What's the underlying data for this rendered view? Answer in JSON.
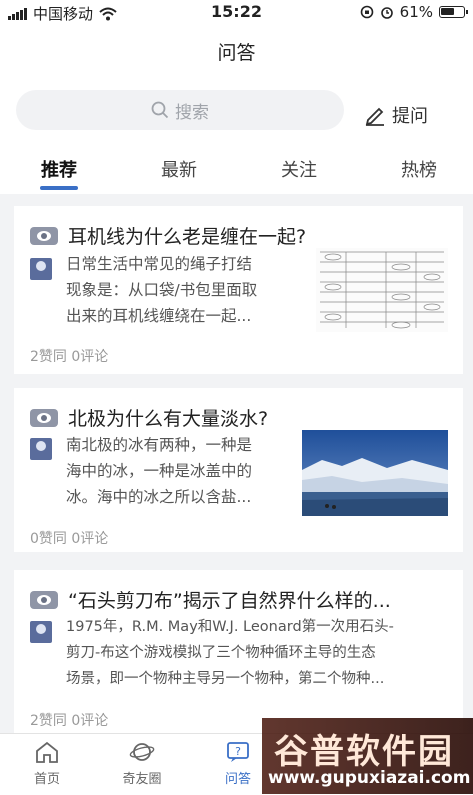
{
  "status_bar": {
    "carrier": "中国移动",
    "time": "15:22",
    "battery": "61%",
    "battery_level": 0.61
  },
  "header": {
    "title": "问答",
    "search_placeholder": "搜索",
    "ask_label": "提问"
  },
  "tabs": [
    {
      "label": "推荐",
      "active": true
    },
    {
      "label": "最新",
      "active": false
    },
    {
      "label": "关注",
      "active": false
    },
    {
      "label": "热榜",
      "active": false
    }
  ],
  "questions": [
    {
      "title": "耳机线为什么老是缠在一起?",
      "excerpt": [
        "日常生活中常见的绳子打结",
        "现象是：从口袋/书包里面取",
        "出来的耳机线缠绕在一起..."
      ],
      "meta": "2赞同 0评论"
    },
    {
      "title": "北极为什么有大量淡水?",
      "excerpt": [
        "南北极的冰有两种，一种是",
        "海中的冰，一种是冰盖中的",
        "冰。海中的冰之所以含盐..."
      ],
      "meta": "0赞同 0评论"
    },
    {
      "title": "“石头剪刀布”揭示了自然界什么样的...",
      "excerpt": [
        "1975年，R.M. May和W.J. Leonard第一次用石头-",
        "剪刀-布这个游戏模拟了三个物种循环主导的生态",
        "场景，即一个物种主导另一个物种，第二个物种..."
      ],
      "meta": "2赞同 0评论"
    }
  ],
  "tab_bar": [
    {
      "label": "首页",
      "icon": "home-icon",
      "active": false
    },
    {
      "label": "奇友圈",
      "icon": "planet-icon",
      "active": false
    },
    {
      "label": "问答",
      "icon": "qa-icon",
      "active": true
    }
  ],
  "watermark": {
    "main": "谷普软件园",
    "url": "www.gupuxiazai.com"
  },
  "colors": {
    "accent": "#3a6fc6",
    "background": "#f2f3f5"
  }
}
